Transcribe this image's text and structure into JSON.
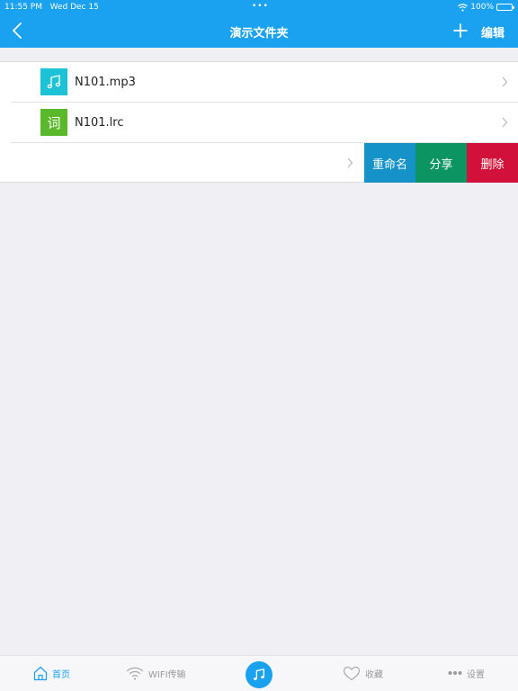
{
  "status_bar": {
    "time": "11:55 PM",
    "date": "Wed Dec 15",
    "battery": "100%",
    "battery_level": 1.0
  },
  "nav": {
    "title": "演示文件夹",
    "edit_label": "编辑",
    "back_icon": "chevron-left-icon",
    "add_icon": "plus-icon"
  },
  "files": [
    {
      "name": "N101.mp3",
      "icon": "music-note-icon",
      "color": "#1cc3d6"
    },
    {
      "name": "N101.lrc",
      "icon_text": "词",
      "icon": "lyrics-icon",
      "color": "#5bb82a"
    }
  ],
  "swipe_actions": {
    "rename": {
      "label": "重命名",
      "color": "#1593c8"
    },
    "share": {
      "label": "分享",
      "color": "#0d9463"
    },
    "delete": {
      "label": "删除",
      "color": "#d2113a"
    }
  },
  "tabbar": {
    "home": "首页",
    "wifi": "WIFI传输",
    "favorites": "收藏",
    "settings": "设置"
  },
  "colors": {
    "accent": "#1aa1f0",
    "background": "#f0f0f4"
  }
}
